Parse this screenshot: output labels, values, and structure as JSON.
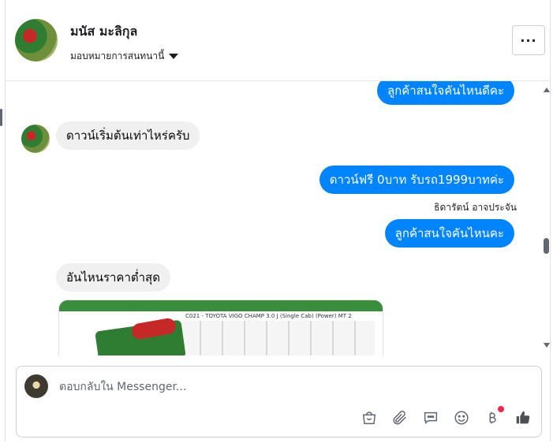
{
  "header": {
    "contact_name": "มนัส มะลิกุล",
    "assign_label": "มอบหมายการสนทนานี้",
    "more_label": "···"
  },
  "messages": [
    {
      "side": "out",
      "text": "ลูกค้าสนใจคันไหนดีคะ"
    },
    {
      "side": "in",
      "text": "ดาวน์เริ่มต้นเท่าไหร่ครับ"
    },
    {
      "side": "out",
      "text": "ดาวน์ฟรี 0บาท รับรถ1999บาทค่ะ"
    },
    {
      "side": "out",
      "text": "ลูกค้าสนใจคันไหนคะ"
    },
    {
      "side": "in",
      "text": "อันไหนราคาต่ำสุด"
    }
  ],
  "agent_name": "ธิดารัตน์ อาจประจัน",
  "image": {
    "caption": "C021 - TOYOTA VIGO CHAMP 3.0 J (Single Cab) (Power) MT 2"
  },
  "composer": {
    "placeholder": "ตอบกลับใน Messenger...",
    "tools": [
      "bag-icon",
      "paperclip-icon",
      "chat-icon",
      "emoji-icon",
      "baht-icon",
      "like-icon"
    ]
  },
  "colors": {
    "outgoing_bubble": "#0084ff",
    "incoming_bubble": "#f0f0f0",
    "notification_dot": "#f02849"
  }
}
